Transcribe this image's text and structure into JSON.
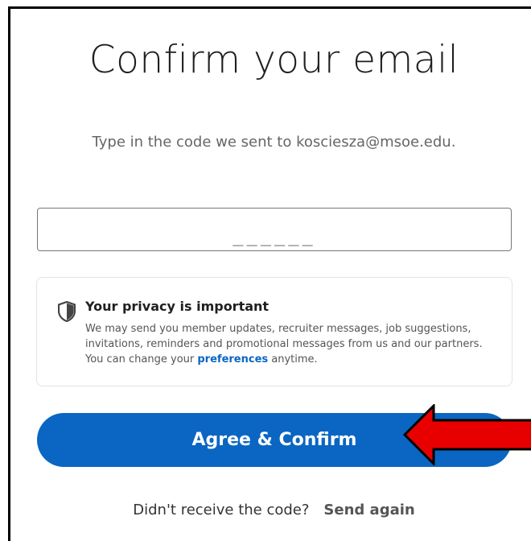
{
  "header": {
    "title": "Confirm your email",
    "subtitle": "Type in the code we sent to kosciesza@msoe.edu."
  },
  "code_field": {
    "placeholder": "______",
    "value": ""
  },
  "privacy": {
    "icon": "shield-icon",
    "heading": "Your privacy is important",
    "body_before_link": "We may send you member updates, recruiter messages, job suggestions, invitations, reminders and promotional messages from us and our partners. You can change your ",
    "link_label": "preferences",
    "body_after_link": " anytime."
  },
  "actions": {
    "agree_label": "Agree & Confirm",
    "resend_question": "Didn't receive the code?",
    "resend_label": "Send again"
  },
  "annotation": {
    "arrow_icon": "red-arrow-left-icon"
  },
  "colors": {
    "primary": "#0a66c2",
    "arrow": "#e80000",
    "frame": "#000000"
  }
}
